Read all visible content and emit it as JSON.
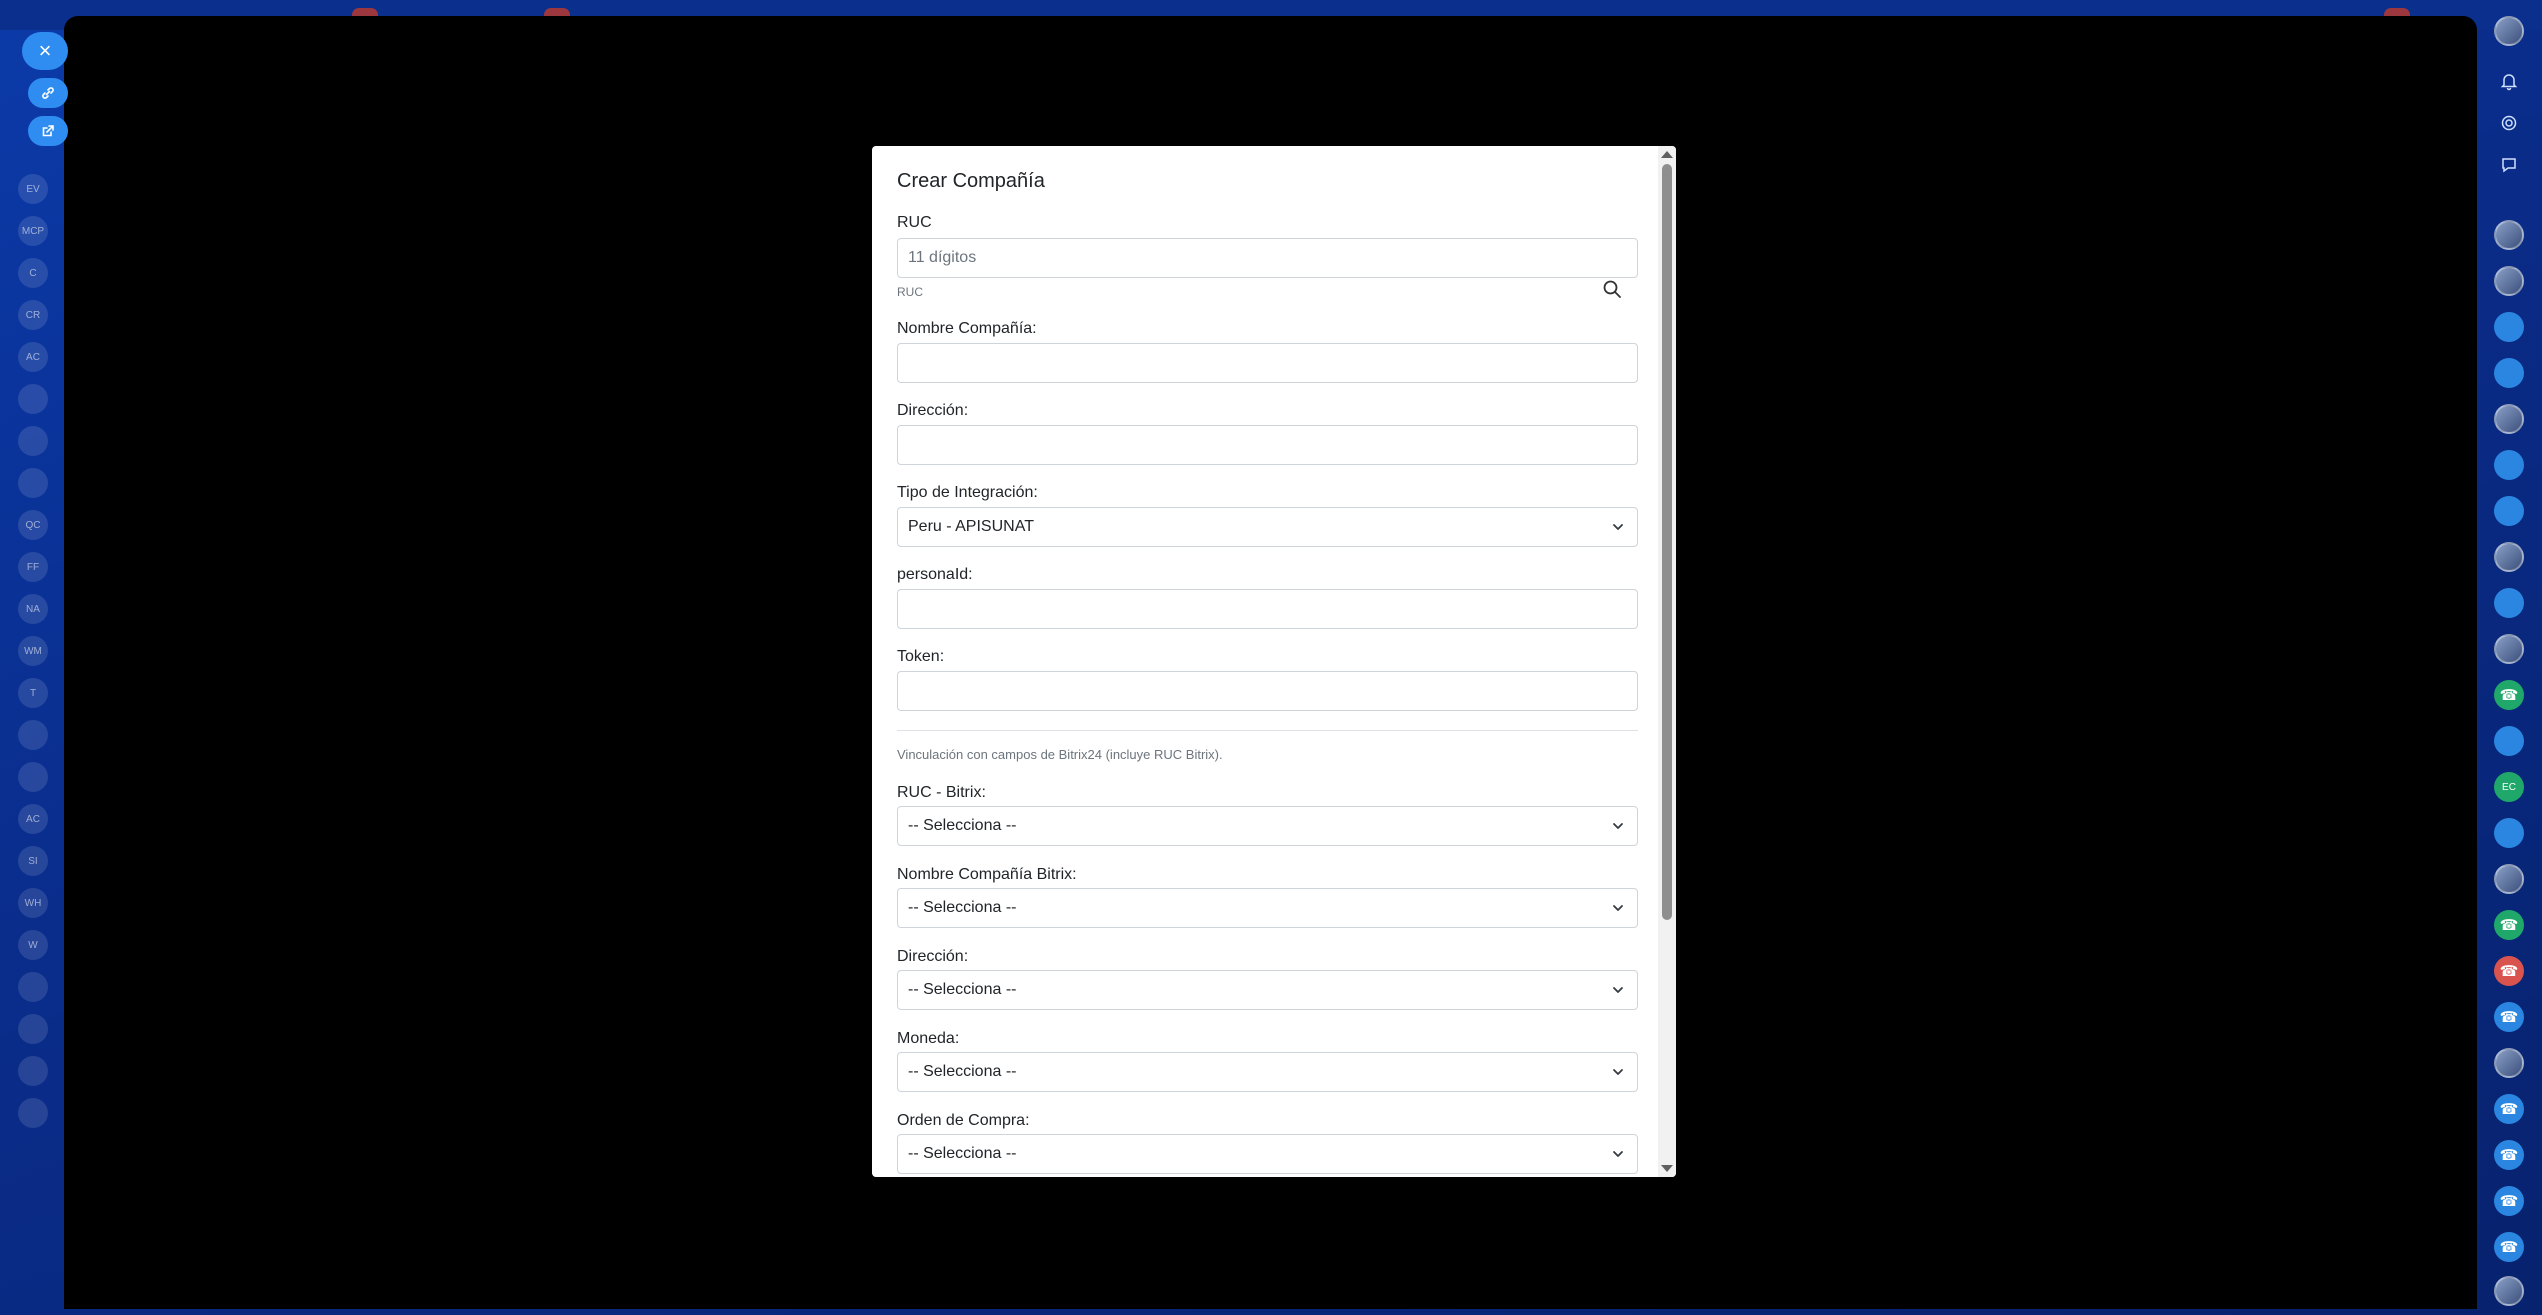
{
  "modal": {
    "title": "Crear Compañía",
    "ruc": {
      "label": "RUC",
      "placeholder": "11 dígitos",
      "hint": "RUC"
    },
    "nombre": {
      "label": "Nombre Compañía:",
      "value": ""
    },
    "direccion": {
      "label": "Dirección:",
      "value": ""
    },
    "tipo_integracion": {
      "label": "Tipo de Integración:",
      "value": "Peru - APISUNAT"
    },
    "personald": {
      "label": "personaId:",
      "value": ""
    },
    "token": {
      "label": "Token:",
      "value": ""
    },
    "vinculacion_hint": "Vinculación con campos de Bitrix24 (incluye RUC Bitrix).",
    "ruc_bitrix": {
      "label": "RUC - Bitrix:",
      "value": "-- Selecciona --"
    },
    "nombre_bitrix": {
      "label": "Nombre Compañía Bitrix:",
      "value": "-- Selecciona --"
    },
    "direccion_bitrix": {
      "label": "Dirección:",
      "value": "-- Selecciona --"
    },
    "moneda": {
      "label": "Moneda:",
      "value": "-- Selecciona --"
    },
    "orden_compra": {
      "label": "Orden de Compra:",
      "value": "-- Selecciona --"
    }
  },
  "background": {
    "close_button": "×",
    "left_nav_initials": [
      "EV",
      "MCP",
      "C",
      "CR",
      "AC",
      "",
      "",
      "",
      "QC",
      "FF",
      "NA",
      "WM",
      "T",
      "",
      "",
      "AC",
      "SI",
      "WH",
      "W",
      "",
      "",
      "",
      ""
    ],
    "right_avatar_initials": [
      "EC"
    ]
  },
  "colors": {
    "accent": "#2f8cf0",
    "overlay": "#000000",
    "app_background": "#0a2c8a"
  }
}
